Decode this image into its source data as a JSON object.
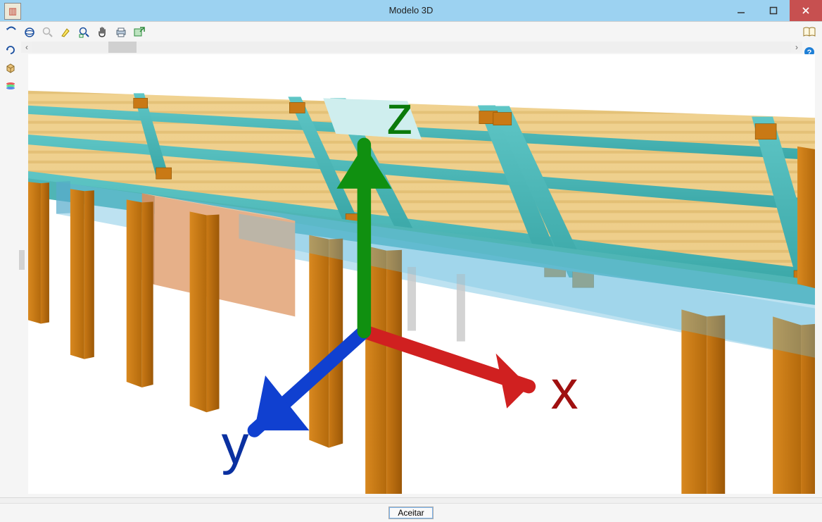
{
  "window": {
    "title": "Modelo 3D"
  },
  "toolbar": {
    "icons": [
      "rotate",
      "orbit",
      "zoom",
      "highlight",
      "zoom-window",
      "pan",
      "print",
      "export"
    ],
    "side_icons": [
      "reset-view",
      "box-view",
      "layers"
    ]
  },
  "buttons": {
    "accept": "Aceitar"
  },
  "axes": {
    "x": "x",
    "y": "y",
    "z": "z"
  }
}
